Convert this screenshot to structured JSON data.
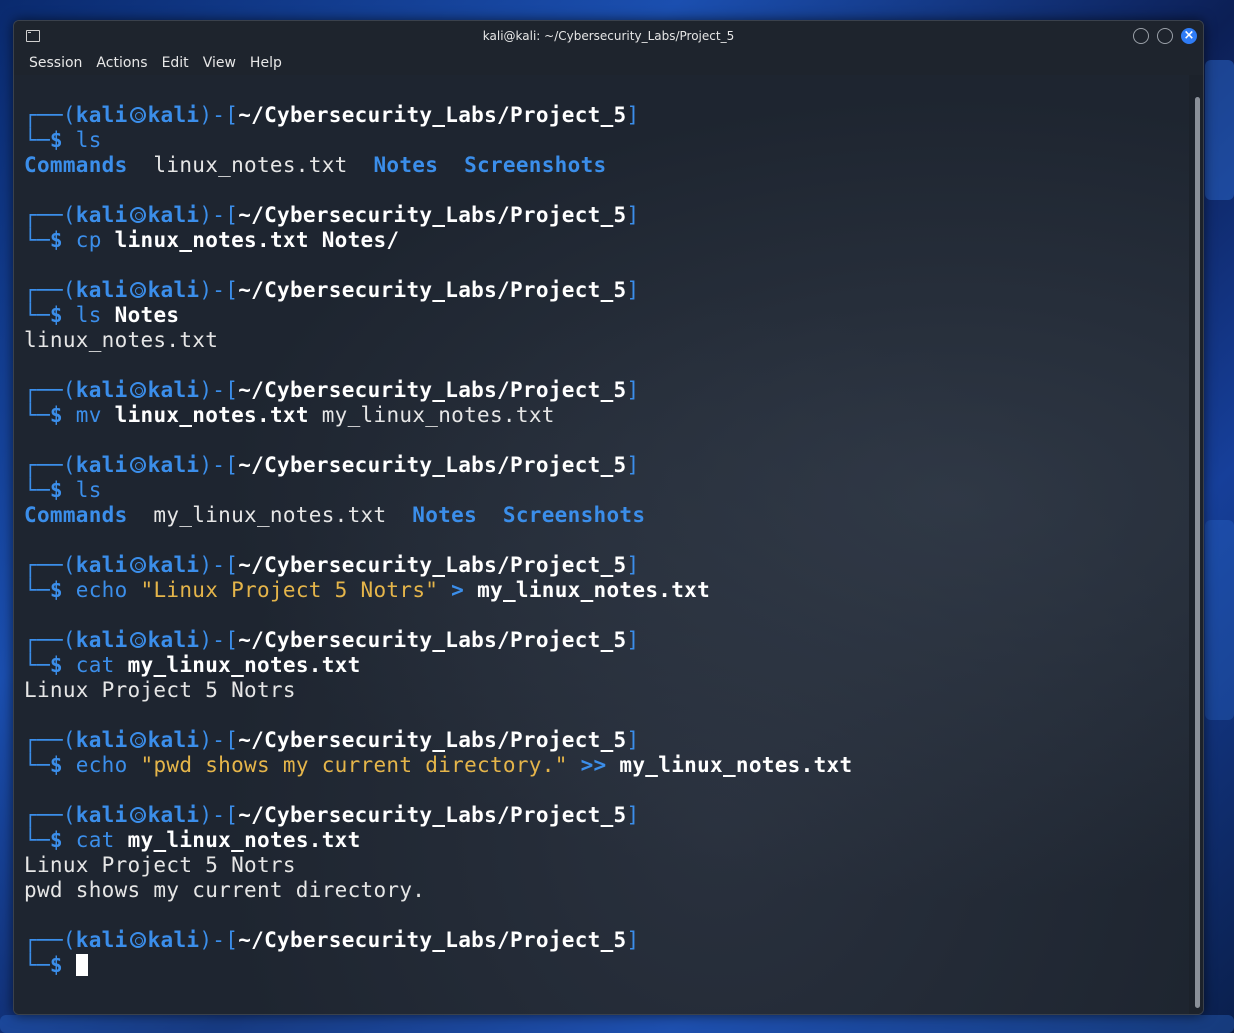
{
  "window": {
    "title": "kali@kali: ~/Cybersecurity_Labs/Project_5"
  },
  "menu": [
    "Session",
    "Actions",
    "Edit",
    "View",
    "Help"
  ],
  "prompt": {
    "user": "kali",
    "host": "kali",
    "path": "~/Cybersecurity_Labs/Project_5",
    "symbol": "$"
  },
  "session": [
    {
      "cmd": "ls",
      "args": [],
      "output": [
        {
          "parts": [
            {
              "text": "Commands",
              "style": "dir"
            },
            {
              "text": "  linux_notes.txt  ",
              "style": "out"
            },
            {
              "text": "Notes",
              "style": "dir"
            },
            {
              "text": "  ",
              "style": "out"
            },
            {
              "text": "Screenshots",
              "style": "dir"
            }
          ]
        }
      ]
    },
    {
      "cmd": "cp",
      "args": [
        {
          "text": "linux_notes.txt Notes/",
          "style": "arg"
        }
      ],
      "output": []
    },
    {
      "cmd": "ls",
      "args": [
        {
          "text": "Notes",
          "style": "arg"
        }
      ],
      "output": [
        {
          "parts": [
            {
              "text": "linux_notes.txt",
              "style": "out"
            }
          ]
        }
      ]
    },
    {
      "cmd": "mv",
      "args": [
        {
          "text": "linux_notes.txt",
          "style": "arg"
        },
        {
          "text": " my_linux_notes.txt",
          "style": "argn"
        }
      ],
      "output": []
    },
    {
      "cmd": "ls",
      "args": [],
      "output": [
        {
          "parts": [
            {
              "text": "Commands",
              "style": "dir"
            },
            {
              "text": "  my_linux_notes.txt  ",
              "style": "out"
            },
            {
              "text": "Notes",
              "style": "dir"
            },
            {
              "text": "  ",
              "style": "out"
            },
            {
              "text": "Screenshots",
              "style": "dir"
            }
          ]
        }
      ]
    },
    {
      "cmd": "echo",
      "args": [
        {
          "text": "\"Linux Project 5 Notrs\"",
          "style": "str"
        },
        {
          "text": " > ",
          "style": "op"
        },
        {
          "text": "my_linux_notes.txt",
          "style": "arg"
        }
      ],
      "output": []
    },
    {
      "cmd": "cat",
      "args": [
        {
          "text": "my_linux_notes.txt",
          "style": "arg"
        }
      ],
      "output": [
        {
          "parts": [
            {
              "text": "Linux Project 5 Notrs",
              "style": "out"
            }
          ]
        }
      ]
    },
    {
      "cmd": "echo",
      "args": [
        {
          "text": "\"pwd shows my current directory.\"",
          "style": "str"
        },
        {
          "text": " >> ",
          "style": "op"
        },
        {
          "text": "my_linux_notes.txt",
          "style": "arg"
        }
      ],
      "output": []
    },
    {
      "cmd": "cat",
      "args": [
        {
          "text": "my_linux_notes.txt",
          "style": "arg"
        }
      ],
      "output": [
        {
          "parts": [
            {
              "text": "Linux Project 5 Notrs",
              "style": "out"
            }
          ]
        },
        {
          "parts": [
            {
              "text": "pwd shows my current directory.",
              "style": "out"
            }
          ]
        }
      ]
    },
    {
      "cmd": "",
      "args": [],
      "output": [],
      "active": true
    }
  ]
}
